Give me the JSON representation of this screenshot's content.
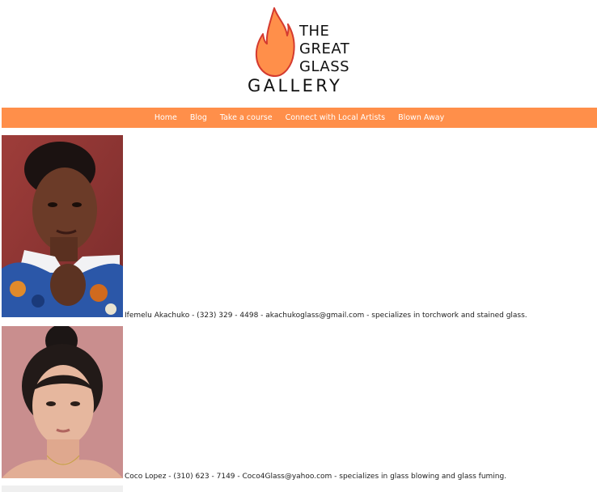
{
  "logo": {
    "line1": "THE",
    "line2": "GREAT",
    "line3": "GLASS",
    "line4": "GALLERY",
    "flame_color": "#ff8f4a",
    "flame_outline": "#d43a2f"
  },
  "nav": {
    "background": "#ff8f4a",
    "items": [
      {
        "label": "Home"
      },
      {
        "label": "Blog"
      },
      {
        "label": "Take a course"
      },
      {
        "label": "Connect with Local Artists"
      },
      {
        "label": "Blown Away"
      }
    ]
  },
  "artists": [
    {
      "info": "Ifemelu Akachuko - (323) 329 - 4498 - akachukoglass@gmail.com - specializes in torchwork and stained glass."
    },
    {
      "info": "Coco Lopez - (310) 623 - 7149 - Coco4Glass@yahoo.com - specializes in glass blowing and glass fuming."
    }
  ]
}
